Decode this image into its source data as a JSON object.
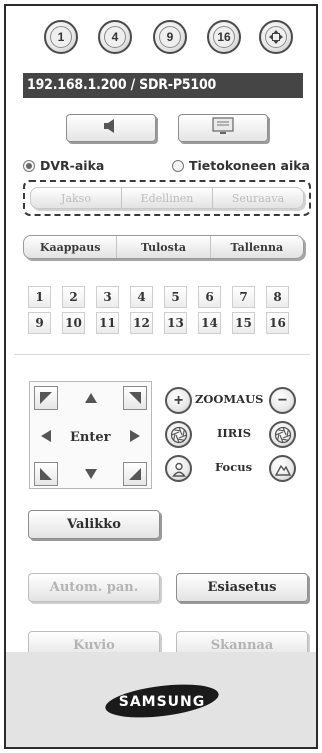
{
  "split_buttons": [
    {
      "label": "1",
      "icon": "split-1-icon"
    },
    {
      "label": "4",
      "icon": "split-4-icon"
    },
    {
      "label": "9",
      "icon": "split-9-icon"
    },
    {
      "label": "16",
      "icon": "split-16-icon"
    },
    {
      "label": "",
      "icon": "move-arrows-icon"
    }
  ],
  "camera": {
    "title": "192.168.1.200 / SDR-P5100"
  },
  "media_buttons": [
    {
      "icon": "speaker-icon"
    },
    {
      "icon": "monitor-icon"
    }
  ],
  "time_source": {
    "options": [
      "DVR-aika",
      "Tietokoneen aika"
    ],
    "selected": "DVR-aika"
  },
  "navigation": {
    "buttons": [
      "Jakso",
      "Edellinen",
      "Seuraava"
    ]
  },
  "capture": {
    "buttons": [
      "Kaappaus",
      "Tulosta",
      "Tallenna"
    ]
  },
  "channels": [
    "1",
    "2",
    "3",
    "4",
    "5",
    "6",
    "7",
    "8",
    "9",
    "10",
    "11",
    "12",
    "13",
    "14",
    "15",
    "16"
  ],
  "ptz": {
    "enter_label": "Enter",
    "zoom_label": "ZOOMAUS",
    "iris_label": "IIRIS",
    "focus_label": "Focus"
  },
  "buttons": {
    "menu": "Valikko",
    "auto_pan": "Autom. pan.",
    "preset": "Esiasetus",
    "pattern": "Kuvio",
    "scan": "Skannaa"
  },
  "brand": {
    "logo_text": "SAMSUNG"
  },
  "colors": {
    "camera_bar_bg": "#454545",
    "footer_bg": "#e3e3e3",
    "logo_bg": "#1a1a1a"
  }
}
